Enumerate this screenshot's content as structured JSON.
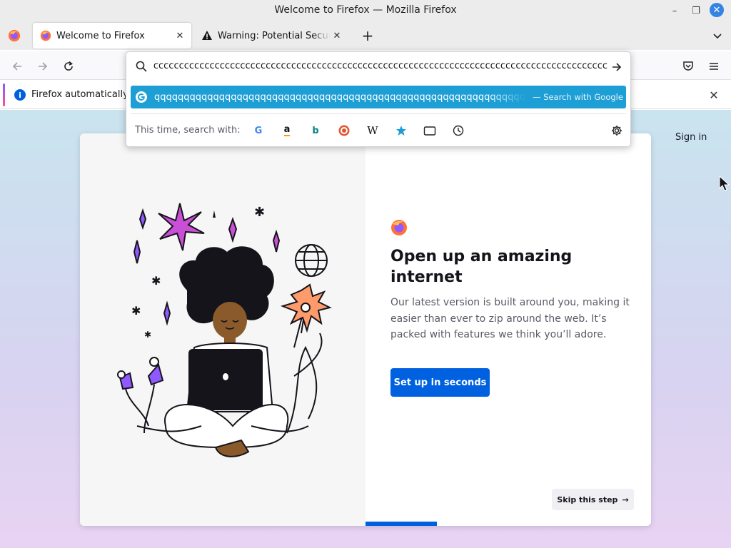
{
  "window": {
    "title": "Welcome to Firefox — Mozilla Firefox",
    "minimize_glyph": "–",
    "maximize_glyph": "❐",
    "close_glyph": "✕"
  },
  "tabs": [
    {
      "label": "Welcome to Firefox",
      "icon": "firefox-icon",
      "active": true,
      "close_glyph": "✕"
    },
    {
      "label": "Warning: Potential Security Risk Ahead",
      "icon": "warning-icon",
      "active": false,
      "close_glyph": "✕"
    }
  ],
  "tabstrip": {
    "new_tab_glyph": "+"
  },
  "urlbar": {
    "value": "cccccccccccccccccccccccccccccccccccccccccccccccccccccccccccccccccccccccccccccccccccccccccccc",
    "result_text": "qqqqqqqqqqqqqqqqqqqqqqqqqqqqqqqqqqqqqqqqqqqqqqqqqqqqqqqqqqqqqqqqqqqqqqqqqqqqqq",
    "result_hint": "— Search with Google",
    "one_off_label": "This time, search with:",
    "engines": [
      "google-icon",
      "amazon-icon",
      "bing-icon",
      "duckduckgo-icon",
      "wikipedia-icon",
      "bookmarks-icon",
      "tabs-icon",
      "history-icon"
    ],
    "engine_glyphs": {
      "google": "G",
      "amazon": "a",
      "bing": "b",
      "wikipedia": "W"
    }
  },
  "notification": {
    "text": "Firefox automatically s",
    "info_glyph": "i",
    "close_glyph": "✕"
  },
  "page": {
    "sign_in": "Sign in",
    "heading": "Open up an amazing internet",
    "body": "Our latest version is built around you, making it easier than ever to zip around the web. It’s packed with features we think you’ll adore.",
    "cta": "Set up in seconds",
    "skip": "Skip this step",
    "skip_arrow": "→"
  },
  "colors": {
    "accent_blue": "#0061e0",
    "highlight_blue": "#1d9fd6",
    "close_button_blue": "#3584e4"
  }
}
